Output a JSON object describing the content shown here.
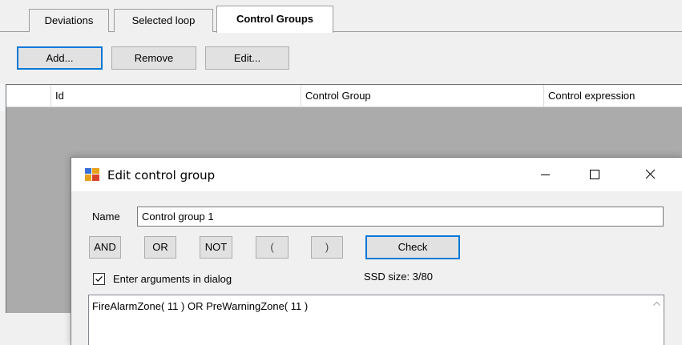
{
  "tabs": [
    {
      "label": "Deviations"
    },
    {
      "label": "Selected loop"
    },
    {
      "label": "Control Groups"
    }
  ],
  "actions": {
    "add": "Add...",
    "remove": "Remove",
    "edit": "Edit..."
  },
  "toolbar": {
    "icons": [
      "print-icon",
      "save-icon"
    ]
  },
  "grid": {
    "columns": [
      "Id",
      "Control Group",
      "Control expression"
    ]
  },
  "dialog": {
    "title": "Edit control group",
    "name_label": "Name",
    "name_value": "Control group 1",
    "operators": {
      "and": "AND",
      "or": "OR",
      "not": "NOT",
      "lparen": "(",
      "rparen": ")"
    },
    "check_label": "Check",
    "checkbox_label": "Enter arguments in dialog",
    "checkbox_checked": true,
    "ssd_size": "SSD size: 3/80",
    "expression": "FireAlarmZone( 11 ) OR PreWarningZone( 11 )"
  },
  "colors": {
    "accent": "#0078d7",
    "grid_empty": "#ababab",
    "panel": "#f0f0f0"
  }
}
